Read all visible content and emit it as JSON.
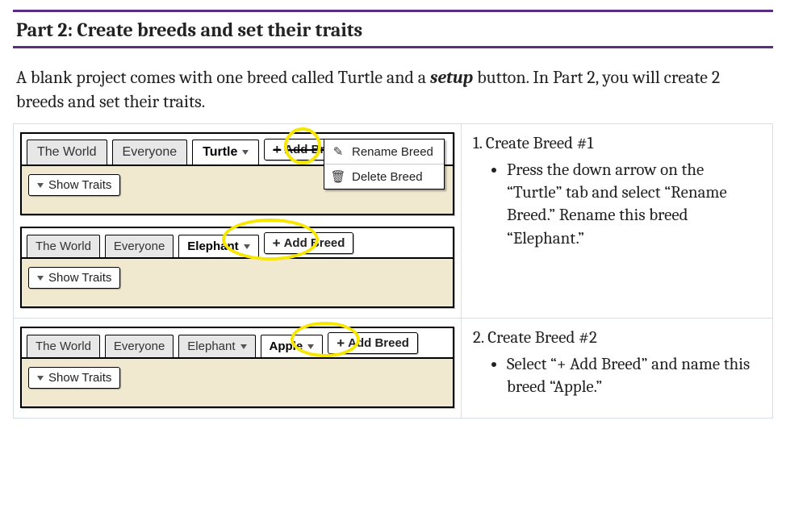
{
  "section_title": "Part 2: Create breeds and set their traits",
  "intro": {
    "pre": "A blank project comes with one breed called Turtle and a ",
    "setup_word": "setup",
    "post": " button. In Part 2, you will create 2 breeds and set their traits."
  },
  "ui": {
    "tab_world": "The World",
    "tab_everyone": "Everyone",
    "tab_turtle": "Turtle",
    "tab_elephant": "Elephant",
    "tab_apple": "Apple",
    "add_breed": "Add Breed",
    "show_traits": "Show Traits",
    "menu_rename": "Rename Breed",
    "menu_delete": "Delete Breed"
  },
  "steps": {
    "s1_title": "1. Create Breed #1",
    "s1_b1": "Press the down arrow on the “Turtle” tab and select “Rename Breed.” Rename this breed “Elephant.”",
    "s2_title": "2. Create Breed #2",
    "s2_b1": "Select “+ Add Breed” and name this breed “Apple.”"
  }
}
